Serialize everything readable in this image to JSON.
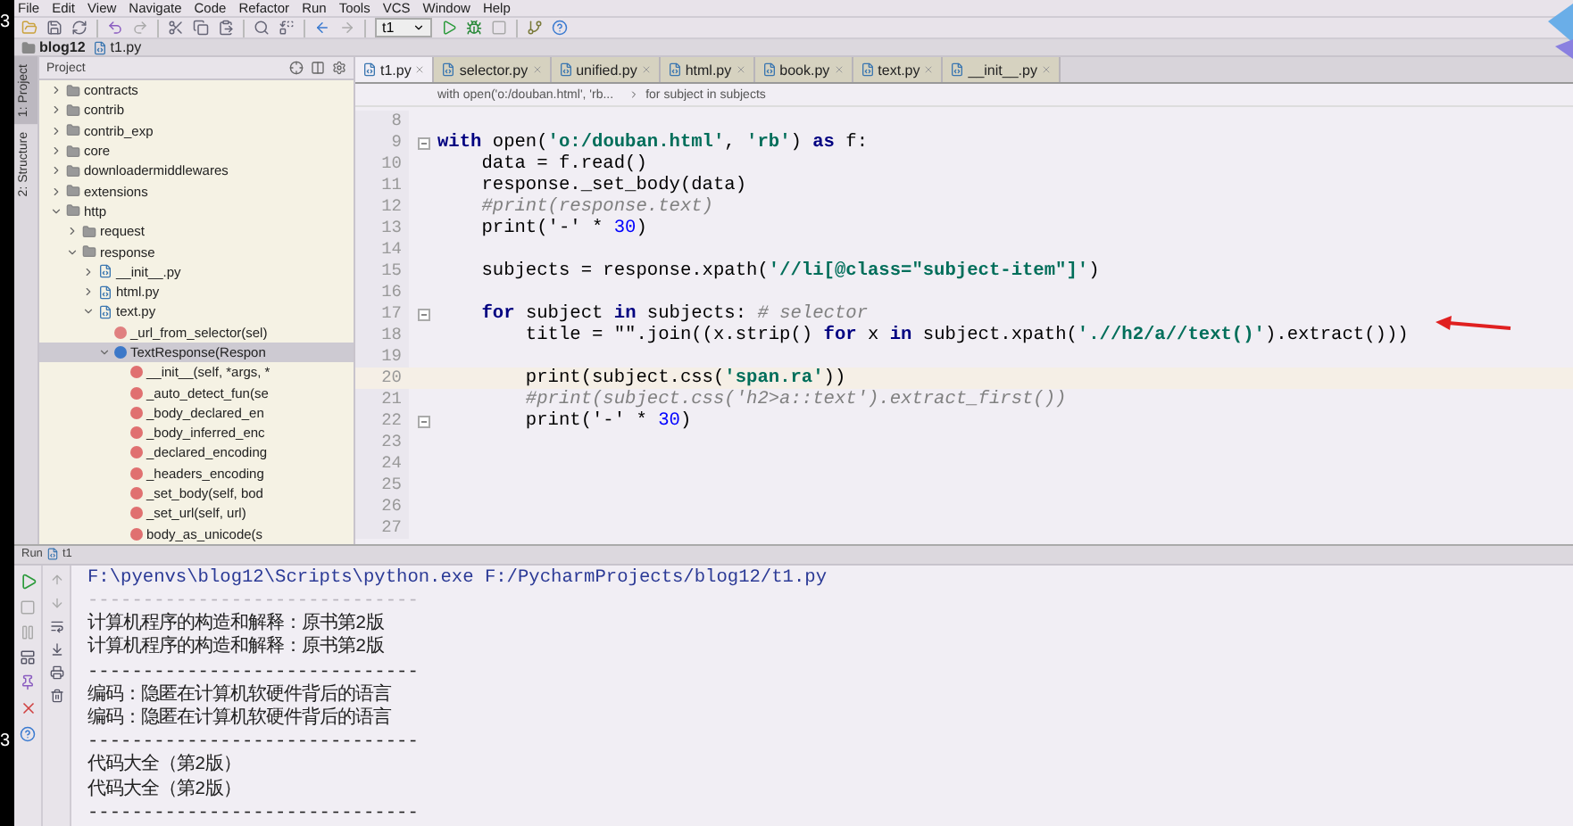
{
  "edge_marks": [
    "3",
    "3"
  ],
  "menu": [
    "File",
    "Edit",
    "View",
    "Navigate",
    "Code",
    "Refactor",
    "Run",
    "Tools",
    "VCS",
    "Window",
    "Help"
  ],
  "toolbar": {
    "run_config": "t1"
  },
  "navigation": [
    "blog12",
    "t1.py"
  ],
  "side_tabs": [
    {
      "label": "1: Project",
      "selected": true
    },
    {
      "label": "2: Structure",
      "selected": false
    }
  ],
  "project_panel": {
    "title": "Project",
    "tree": [
      {
        "label": "contracts",
        "kind": "folder",
        "expanded": false
      },
      {
        "label": "contrib",
        "kind": "folder",
        "expanded": false
      },
      {
        "label": "contrib_exp",
        "kind": "folder",
        "expanded": false
      },
      {
        "label": "core",
        "kind": "folder",
        "expanded": false
      },
      {
        "label": "downloadermiddlewares",
        "kind": "folder",
        "expanded": false
      },
      {
        "label": "extensions",
        "kind": "folder",
        "expanded": false
      },
      {
        "label": "http",
        "kind": "folder",
        "expanded": true,
        "children": [
          {
            "label": "request",
            "kind": "folder",
            "expanded": false
          },
          {
            "label": "response",
            "kind": "folder",
            "expanded": true,
            "children": [
              {
                "label": "__init__.py",
                "kind": "file",
                "expanded": false
              },
              {
                "label": "html.py",
                "kind": "file",
                "expanded": false
              },
              {
                "label": "text.py",
                "kind": "file",
                "expanded": true,
                "children": [
                  {
                    "label": "_url_from_selector(sel)",
                    "kind": "function",
                    "selected": false
                  },
                  {
                    "label": "TextResponse(Respon",
                    "kind": "class",
                    "expanded": true,
                    "selected": true,
                    "children": [
                      {
                        "label": "__init__(self, *args, *",
                        "kind": "method",
                        "selected": false
                      },
                      {
                        "label": "_auto_detect_fun(se",
                        "kind": "method",
                        "selected": false
                      },
                      {
                        "label": "_body_declared_en",
                        "kind": "method",
                        "selected": false
                      },
                      {
                        "label": "_body_inferred_enc",
                        "kind": "method",
                        "selected": false
                      },
                      {
                        "label": "_declared_encoding",
                        "kind": "method",
                        "selected": false
                      },
                      {
                        "label": "_headers_encoding",
                        "kind": "method",
                        "selected": false
                      },
                      {
                        "label": "_set_body(self, bod",
                        "kind": "method",
                        "selected": false
                      },
                      {
                        "label": "_set_url(self, url)",
                        "kind": "method",
                        "selected": false
                      },
                      {
                        "label": "body_as_unicode(s",
                        "kind": "method",
                        "selected": false
                      }
                    ]
                  }
                ]
              }
            ]
          }
        ]
      }
    ]
  },
  "editor": {
    "tabs": [
      {
        "label": "t1.py",
        "selected": true
      },
      {
        "label": "selector.py",
        "selected": false
      },
      {
        "label": "unified.py",
        "selected": false
      },
      {
        "label": "html.py",
        "selected": false
      },
      {
        "label": "book.py",
        "selected": false
      },
      {
        "label": "text.py",
        "selected": false
      },
      {
        "label": "__init__.py",
        "selected": false
      }
    ],
    "breadcrumb": [
      "with open('o:/douban.html', 'rb...",
      "for subject in subjects"
    ],
    "lines": [
      {
        "number": "8",
        "current": false,
        "fold": false
      },
      {
        "number": "9",
        "current": false,
        "fold": true,
        "tokens": [
          {
            "kind": "keyword",
            "text": "with"
          },
          {
            "kind": "plain",
            "text": " open("
          },
          {
            "kind": "string",
            "text": "'o:/douban.html'"
          },
          {
            "kind": "plain",
            "text": ", "
          },
          {
            "kind": "string",
            "text": "'rb'"
          },
          {
            "kind": "plain",
            "text": ") "
          },
          {
            "kind": "keyword",
            "text": "as"
          },
          {
            "kind": "plain",
            "text": " f:"
          }
        ]
      },
      {
        "number": "10",
        "current": false,
        "fold": false,
        "tokens": [
          {
            "kind": "plain",
            "text": "    data = f.read()"
          }
        ]
      },
      {
        "number": "11",
        "current": false,
        "fold": false,
        "tokens": [
          {
            "kind": "plain",
            "text": "    response._set_body(data)"
          }
        ]
      },
      {
        "number": "12",
        "current": false,
        "fold": false,
        "tokens": [
          {
            "kind": "comment",
            "text": "    #print(response.text)"
          }
        ]
      },
      {
        "number": "13",
        "current": false,
        "fold": false,
        "tokens": [
          {
            "kind": "plain",
            "text": "    print('-' * "
          },
          {
            "kind": "number",
            "text": "30"
          },
          {
            "kind": "plain",
            "text": ")"
          }
        ]
      },
      {
        "number": "14",
        "current": false,
        "fold": false
      },
      {
        "number": "15",
        "current": false,
        "fold": false,
        "tokens": [
          {
            "kind": "plain",
            "text": "    subjects = response.xpath("
          },
          {
            "kind": "string",
            "text": "'//li[@class=\"subject-item\"]'"
          },
          {
            "kind": "plain",
            "text": ")"
          }
        ]
      },
      {
        "number": "16",
        "current": false,
        "fold": false
      },
      {
        "number": "17",
        "current": false,
        "fold": true,
        "tokens": [
          {
            "kind": "keyword",
            "text": "    for"
          },
          {
            "kind": "plain",
            "text": " subject "
          },
          {
            "kind": "keyword",
            "text": "in"
          },
          {
            "kind": "plain",
            "text": " subjects: "
          },
          {
            "kind": "comment",
            "text": "# selector"
          }
        ]
      },
      {
        "number": "18",
        "current": false,
        "fold": false,
        "tokens": [
          {
            "kind": "plain",
            "text": "        title = \"\".join((x.strip() "
          },
          {
            "kind": "keyword",
            "text": "for"
          },
          {
            "kind": "plain",
            "text": " x "
          },
          {
            "kind": "keyword",
            "text": "in"
          },
          {
            "kind": "plain",
            "text": " subject.xpath("
          },
          {
            "kind": "string",
            "text": "'.//h2/a//text()'"
          },
          {
            "kind": "plain",
            "text": ").extract()))"
          }
        ]
      },
      {
        "number": "19",
        "current": false,
        "fold": false
      },
      {
        "number": "20",
        "current": true,
        "fold": false,
        "tokens": [
          {
            "kind": "plain",
            "text": "        print(subject.css("
          },
          {
            "kind": "string",
            "text": "'span.ra'"
          },
          {
            "kind": "plain",
            "text": "))"
          }
        ]
      },
      {
        "number": "21",
        "current": false,
        "fold": false,
        "tokens": [
          {
            "kind": "comment",
            "text": "        #print(subject.css('h2>a::text').extract_first())"
          }
        ]
      },
      {
        "number": "22",
        "current": false,
        "fold": true,
        "tokens": [
          {
            "kind": "plain",
            "text": "        print('-' * "
          },
          {
            "kind": "number",
            "text": "30"
          },
          {
            "kind": "plain",
            "text": ")"
          }
        ]
      },
      {
        "number": "23",
        "current": false,
        "fold": false
      },
      {
        "number": "24",
        "current": false,
        "fold": false
      },
      {
        "number": "25",
        "current": false,
        "fold": false
      },
      {
        "number": "26",
        "current": false,
        "fold": false
      },
      {
        "number": "27",
        "current": false,
        "fold": false
      }
    ]
  },
  "run_panel": {
    "title": "Run",
    "config": "t1",
    "console": [
      {
        "kind": "command",
        "text": "F:\\pyenvs\\blog12\\Scripts\\python.exe F:/PycharmProjects/blog12/t1.py"
      },
      {
        "kind": "faint",
        "text": "------------------------------"
      },
      {
        "kind": "output",
        "text": "计算机程序的构造和解释：原书第2版"
      },
      {
        "kind": "output",
        "text": "计算机程序的构造和解释：原书第2版"
      },
      {
        "kind": "output",
        "text": "------------------------------"
      },
      {
        "kind": "output",
        "text": "编码：隐匿在计算机软硬件背后的语言"
      },
      {
        "kind": "output",
        "text": "编码：隐匿在计算机软硬件背后的语言"
      },
      {
        "kind": "output",
        "text": "------------------------------"
      },
      {
        "kind": "output",
        "text": "代码大全（第2版）"
      },
      {
        "kind": "output",
        "text": "代码大全（第2版）"
      },
      {
        "kind": "output",
        "text": "------------------------------"
      }
    ]
  }
}
